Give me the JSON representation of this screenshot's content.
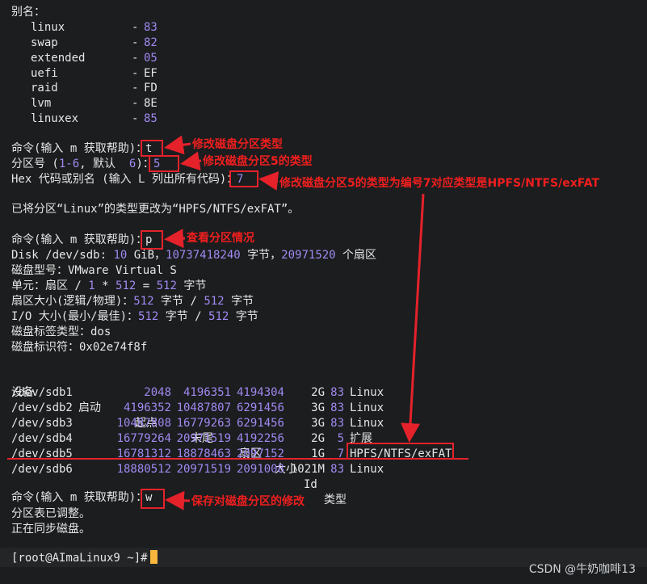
{
  "alias_header": "别名：",
  "aliases": [
    {
      "name": "linux",
      "code": "83"
    },
    {
      "name": "swap",
      "code": "82"
    },
    {
      "name": "extended",
      "code": "05"
    },
    {
      "name": "uefi",
      "code": "EF"
    },
    {
      "name": "raid",
      "code": "FD"
    },
    {
      "name": "lvm",
      "code": "8E"
    },
    {
      "name": "linuxex",
      "code": "85"
    }
  ],
  "dash": "-",
  "cmd_prompt": "命令(输入 m 获取帮助)：",
  "cmd1_value": "t",
  "partno_prefix": "分区号 (",
  "partno_range": "1-6",
  "partno_mid": ", 默认  ",
  "partno_default": "6",
  "partno_suffix": ")：",
  "partno_value": "5",
  "hex_prompt": "Hex 代码或别名 (输入 L 列出所有代码)：",
  "hex_value": "7",
  "changed_msg": "已将分区“Linux”的类型更改为“HPFS/NTFS/exFAT”。",
  "cmd2_value": "p",
  "disk_line": {
    "a": "Disk /dev/sdb: ",
    "size": "10",
    "b": " GiB，",
    "bytes": "10737418240",
    "c": " 字节，",
    "sectors": "20971520",
    "d": " 个扇区"
  },
  "model_line": "磁盘型号：VMware Virtual S",
  "unit_line": {
    "a": "单元：扇区 / ",
    "one": "1",
    "b": " * ",
    "n1": "512",
    "c": " = ",
    "n2": "512",
    "d": " 字节"
  },
  "sector_size_line": {
    "a": "扇区大小(逻辑/物理)：",
    "n1": "512",
    "b": " 字节 / ",
    "n2": "512",
    "c": " 字节"
  },
  "io_size_line": {
    "a": "I/O 大小(最小/最佳)：",
    "n1": "512",
    "b": " 字节 / ",
    "n2": "512",
    "c": " 字节"
  },
  "label_type_line": "磁盘标签类型：dos",
  "identifier_line": "磁盘标识符：0x02e74f8f",
  "table_headers": {
    "device": "设备",
    "boot": "启动",
    "start": "起点",
    "end": "末尾",
    "sectors": "扇区",
    "size": "大小",
    "id": "Id",
    "type": "类型"
  },
  "partitions": [
    {
      "device": "/dev/sdb1",
      "start": "2048",
      "end": "4196351",
      "sectors": "4194304",
      "size": "2G",
      "id": "83",
      "type": "Linux"
    },
    {
      "device": "/dev/sdb2",
      "start": "4196352",
      "end": "10487807",
      "sectors": "6291456",
      "size": "3G",
      "id": "83",
      "type": "Linux"
    },
    {
      "device": "/dev/sdb3",
      "start": "10487808",
      "end": "16779263",
      "sectors": "6291456",
      "size": "3G",
      "id": "83",
      "type": "Linux"
    },
    {
      "device": "/dev/sdb4",
      "start": "16779264",
      "end": "20971519",
      "sectors": "4192256",
      "size": "2G",
      "id": "5",
      "type": "扩展"
    },
    {
      "device": "/dev/sdb5",
      "start": "16781312",
      "end": "18878463",
      "sectors": "2097152",
      "size": "1G",
      "id": "7",
      "type": "HPFS/NTFS/exFAT"
    },
    {
      "device": "/dev/sdb6",
      "start": "18880512",
      "end": "20971519",
      "sectors": "2091008",
      "size": "1021M",
      "id": "83",
      "type": "Linux"
    }
  ],
  "cmd3_value": "w",
  "table_adjusted": "分区表已调整。",
  "syncing": "正在同步磁盘。",
  "shell_prompt": "[root@AImaLinux9 ~]#",
  "annotations": {
    "a1": "修改磁盘分区类型",
    "a2": "修改磁盘分区5的类型",
    "a3": "修改磁盘分区5的类型为编号7对应类型是HPFS/NTFS/exFAT",
    "a4": "查看分区情况",
    "a5": "保存对磁盘分区的修改"
  },
  "watermark": "CSDN @牛奶咖啡13",
  "colors": {
    "background": "#1b1d1f",
    "text": "#e6e6e6",
    "number": "#a189f0",
    "annotation": "#f01e1e",
    "cursor": "#f6b73c"
  }
}
